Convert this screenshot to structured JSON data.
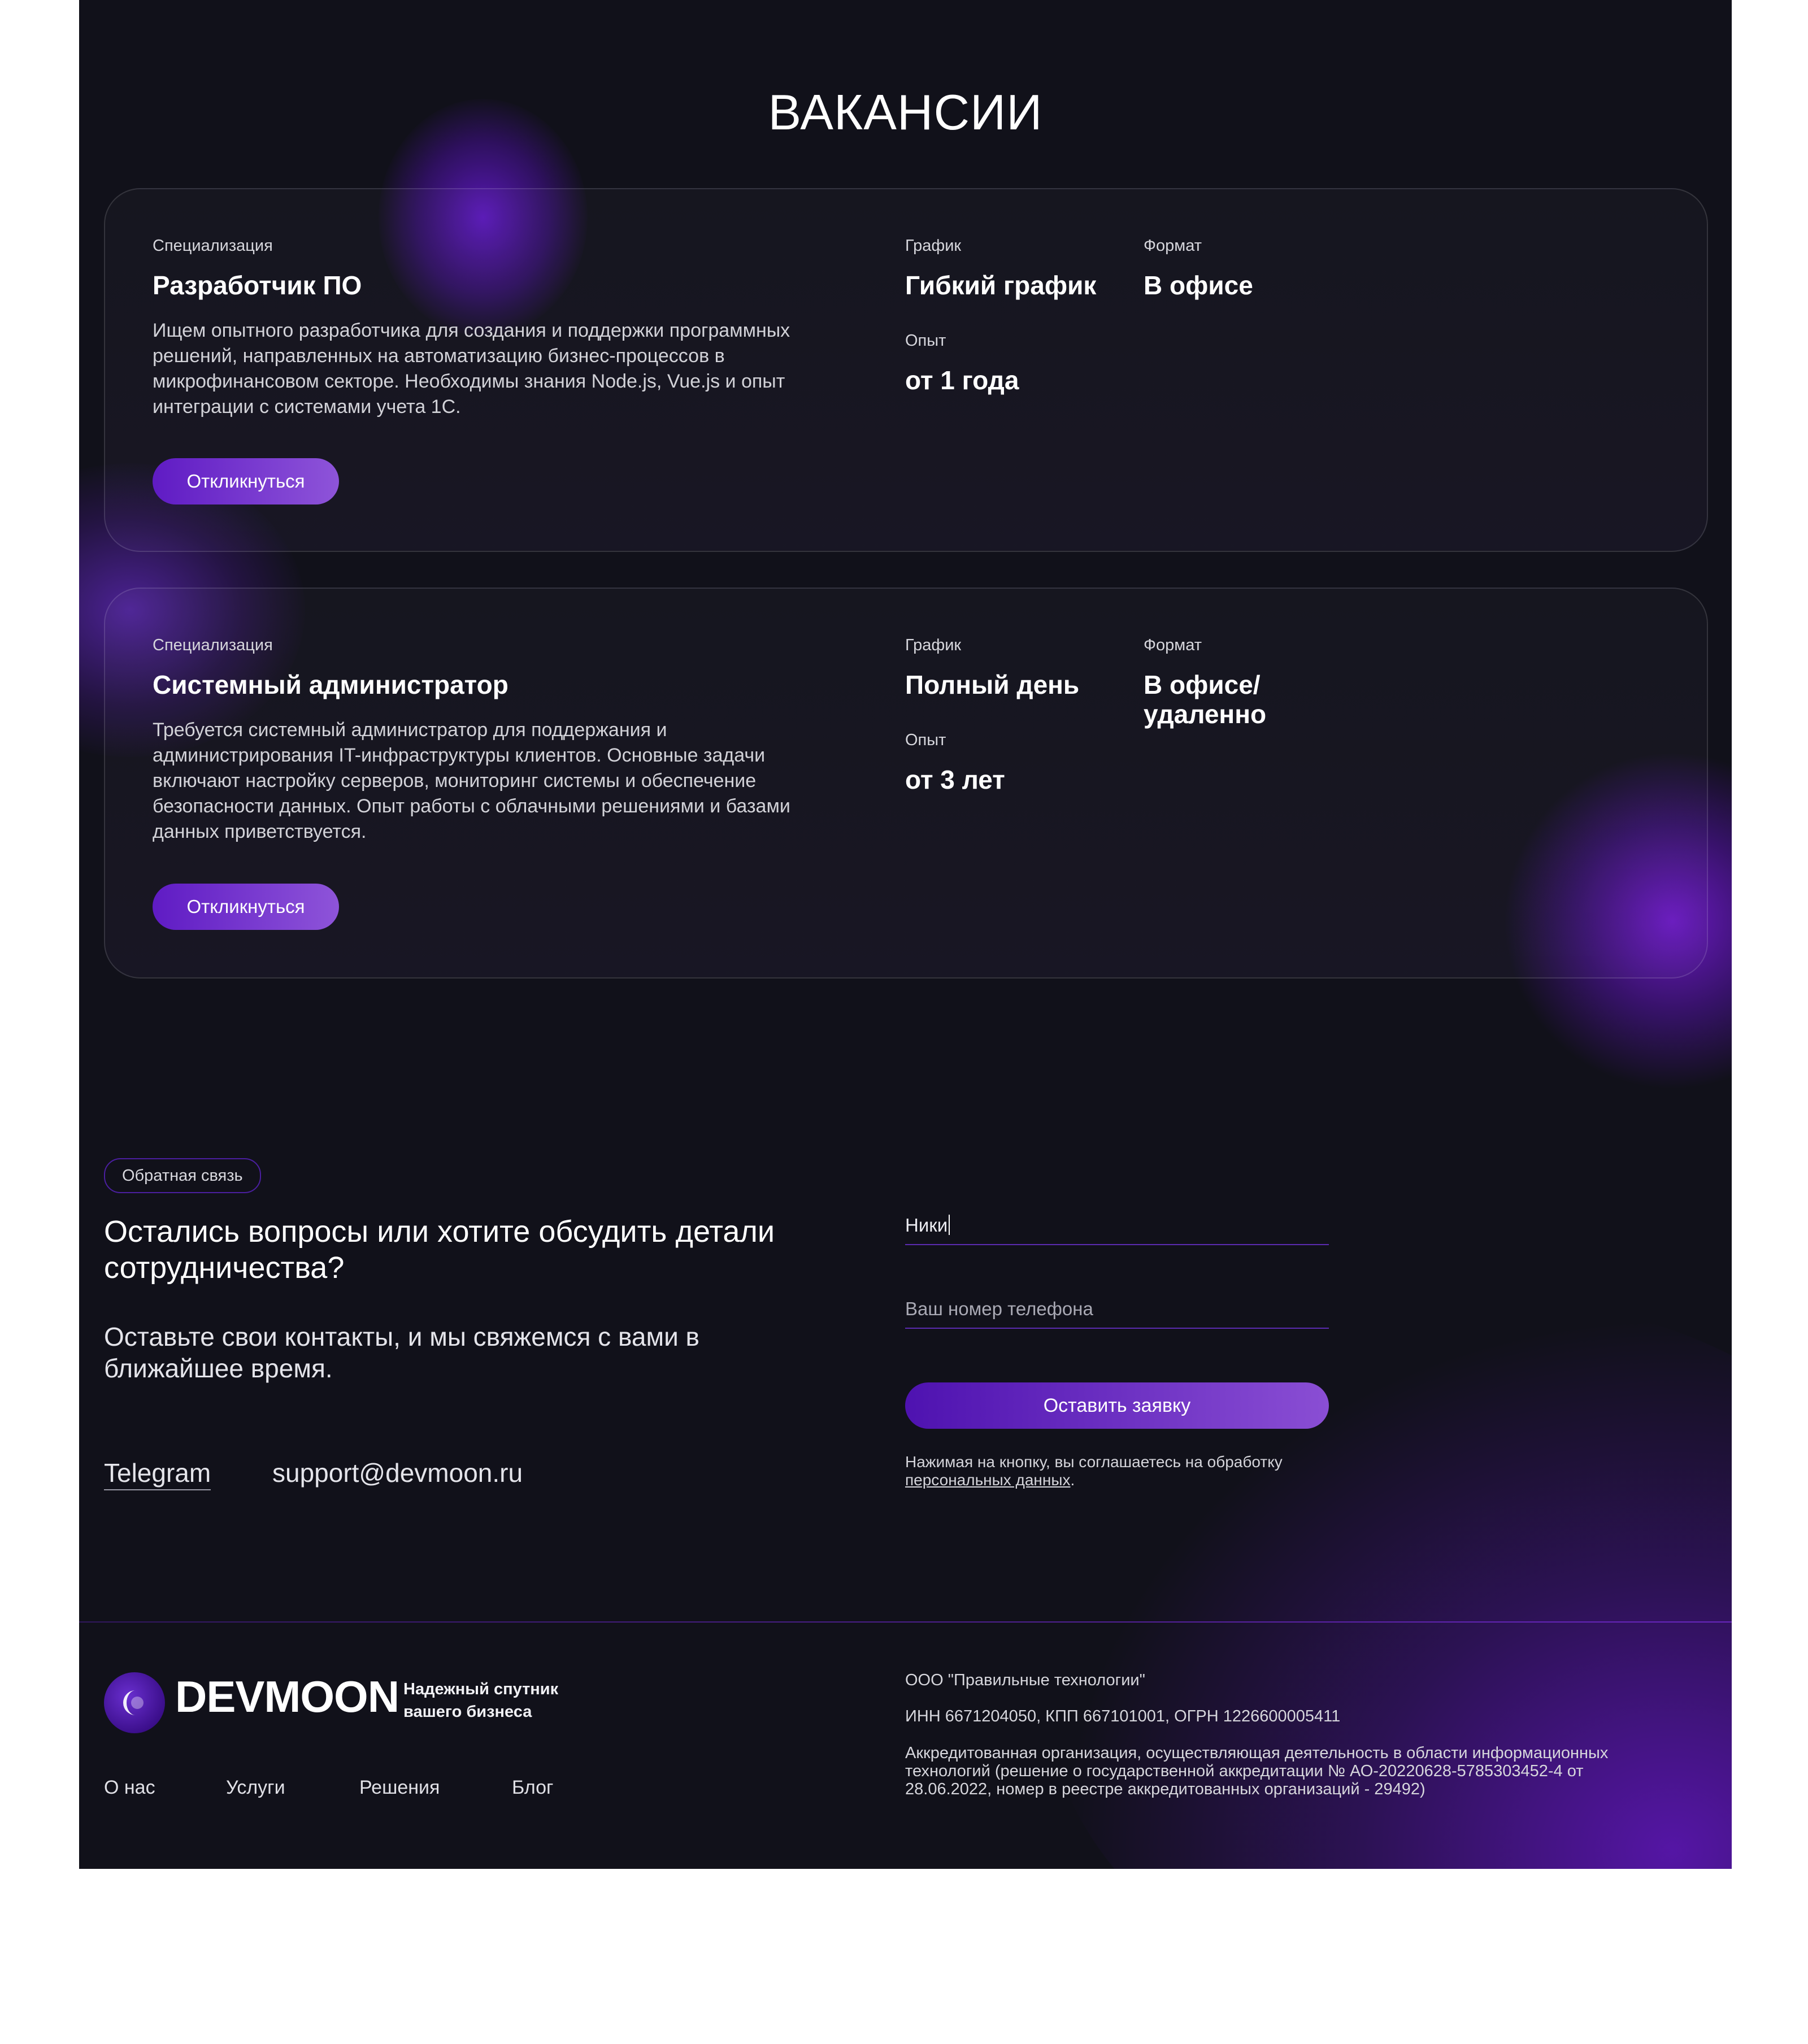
{
  "vacancies": {
    "title": "ВАКАНСИИ",
    "items": [
      {
        "spec_label": "Специализация",
        "spec": "Разработчик ПО",
        "description": "Ищем опытного разработчика для создания и поддержки программных решений, направленных на автоматизацию бизнес-процессов в микрофинансовом секторе. Необходимы знания Node.js, Vue.js и опыт интеграции с системами учета 1С.",
        "schedule_label": "График",
        "schedule": "Гибкий график",
        "format_label": "Формат",
        "format": "В офисе",
        "experience_label": "Опыт",
        "experience": "от 1 года",
        "apply_label": "Откликнуться"
      },
      {
        "spec_label": "Специализация",
        "spec": "Системный администратор",
        "description": "Требуется системный администратор для поддержания и администрирования IT-инфраструктуры клиентов. Основные задачи включают настройку серверов, мониторинг системы и обеспечение безопасности данных. Опыт работы с облачными решениями и базами данных приветствуется.",
        "schedule_label": "График",
        "schedule": "Полный день",
        "format_label": "Формат",
        "format": "В офисе/ удаленно",
        "experience_label": "Опыт",
        "experience": "от 3 лет",
        "apply_label": "Откликнуться"
      }
    ]
  },
  "feedback": {
    "badge": "Обратная связь",
    "heading": "Остались вопросы или хотите обсудить детали сотрудничества?",
    "subheading": "Оставьте свои контакты, и мы свяжемся с вами в ближайшее время.",
    "telegram": "Telegram",
    "email": "support@devmoon.ru",
    "form": {
      "name_value": "Ники",
      "phone_placeholder": "Ваш номер телефона",
      "submit_label": "Оставить заявку",
      "consent_text": "Нажимая на кнопку, вы соглашаетесь на обработку",
      "consent_link": "персональных данных",
      "consent_end": "."
    }
  },
  "footer": {
    "logo": "DEVMOON",
    "tagline": "Надежный спутник вашего бизнеса",
    "nav": [
      "О нас",
      "Услуги",
      "Решения",
      "Блог"
    ],
    "company": "ООО \"Правильные технологии\"",
    "requisites": "ИНН 6671204050, КПП 667101001, ОГРН 1226600005411",
    "accreditation": "Аккредитованная организация, осуществляющая деятельность в области информационных технологий (решение о государственной аккредитации № АО-20220628-5785303452-4 от 28.06.2022, номер в реестре аккредитованных организаций - 29492)"
  },
  "colors": {
    "background": "#11111a",
    "accent": "#6a2fd0",
    "accent_light": "#8e54d9"
  }
}
